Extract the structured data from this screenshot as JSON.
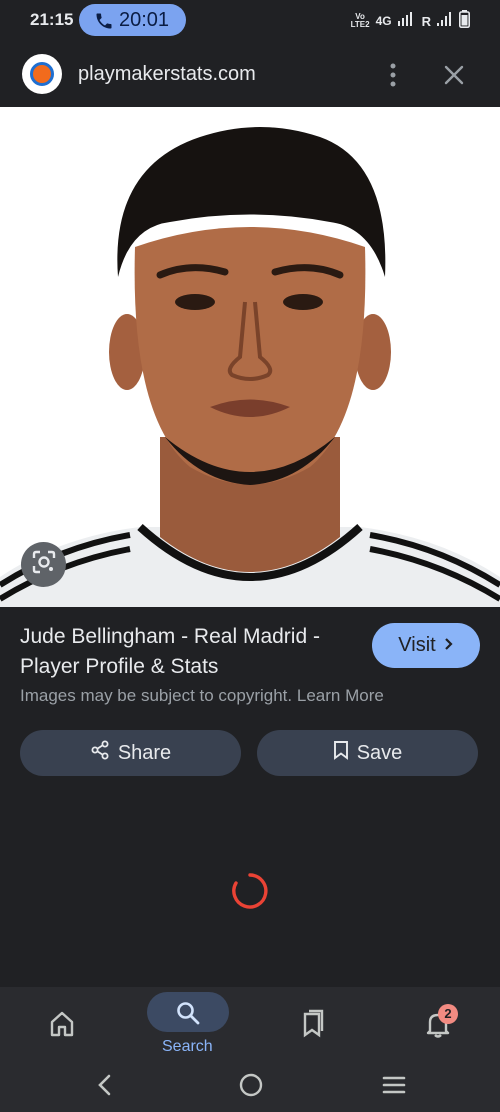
{
  "status_bar": {
    "time": "21:15",
    "call_timer": "20:01",
    "volte_line1": "Vo",
    "volte_line2": "LTE2",
    "network": "4G",
    "roaming": "R"
  },
  "browser": {
    "domain": "playmakerstats.com",
    "icons": [
      "more-vert-icon",
      "close-icon"
    ]
  },
  "image": {
    "description_icon": "google-lens-icon"
  },
  "result": {
    "title": "Jude Bellingham - Real Madrid - Player Profile & Stats",
    "visit_label": "Visit",
    "copyright_text": "Images may be subject to copyright.",
    "learn_more_label": "Learn More",
    "share_label": "Share",
    "save_label": "Save"
  },
  "bottom_nav": {
    "items": [
      {
        "label": "",
        "icon": "home-icon"
      },
      {
        "label": "Search",
        "icon": "search-icon",
        "active": true
      },
      {
        "label": "",
        "icon": "saved-icon"
      },
      {
        "label": "",
        "icon": "notifications-icon"
      }
    ],
    "notification_count": "2"
  },
  "colors": {
    "background": "#202124",
    "accent": "#8ab4f8",
    "button": "#394150",
    "spinner": "#ea4335",
    "badge": "#f28b82"
  }
}
